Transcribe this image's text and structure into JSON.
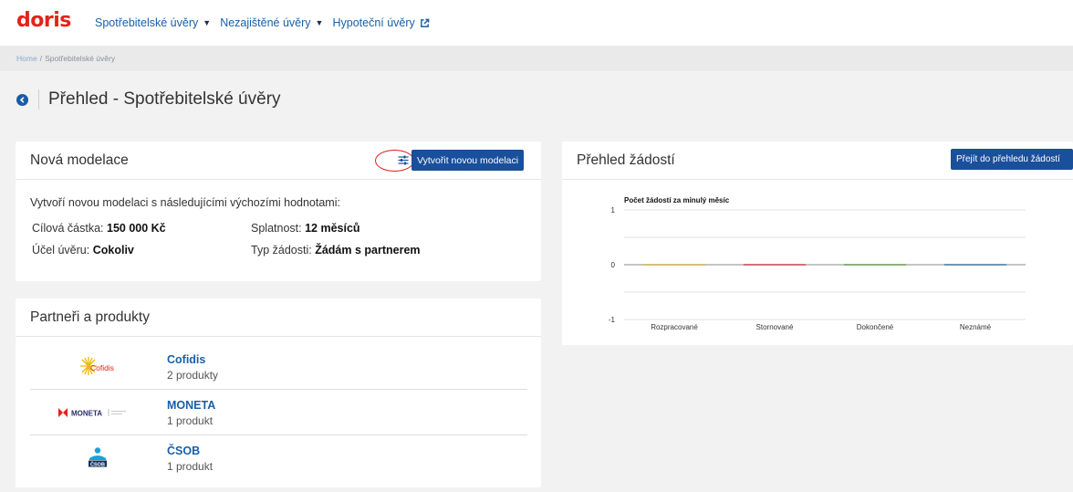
{
  "nav": {
    "logo": "doris",
    "items": [
      {
        "label": "Spotřebitelské úvěry",
        "icon": "caret-down-icon"
      },
      {
        "label": "Nezajištěné úvěry",
        "icon": "caret-down-icon"
      },
      {
        "label": "Hypoteční úvěry",
        "icon": "external-link-icon"
      }
    ]
  },
  "breadcrumb": {
    "home": "Home",
    "separator": "/",
    "current": "Spotřebitelské úvěry"
  },
  "page": {
    "title": "Přehled - Spotřebitelské úvěry",
    "back_icon": "back-arrow-icon"
  },
  "nova": {
    "title": "Nová modelace",
    "settings_icon": "sliders-icon",
    "create_button": "Vytvořit novou modelaci",
    "description": "Vytvoří novou modelaci s následujícími výchozími hodnotami:",
    "fields": {
      "amount_label": "Cílová částka:",
      "amount_value": "150 000 Kč",
      "maturity_label": "Splatnost:",
      "maturity_value": "12 měsíců",
      "purpose_label": "Účel úvěru:",
      "purpose_value": "Cokoliv",
      "type_label": "Typ žádosti:",
      "type_value": "Žádám s partnerem"
    }
  },
  "partners": {
    "title": "Partneři a produkty",
    "items": [
      {
        "name": "Cofidis",
        "count": "2 produkty",
        "logo_text": "Cofidis"
      },
      {
        "name": "MONETA",
        "count": "1 produkt",
        "logo_text": "MONETA"
      },
      {
        "name": "ČSOB",
        "count": "1 produkt",
        "logo_text": "ČSOB"
      }
    ]
  },
  "prehled": {
    "title": "Přehled žádostí",
    "button": "Přejít do přehledu žádostí"
  },
  "colors": {
    "brand_red": "#e2231a",
    "link_blue": "#1a5fa8",
    "button_blue": "#1a4f9c",
    "annotation_red": "#e11d1d"
  },
  "chart_data": {
    "type": "bar",
    "title": "Počet žádostí za minulý měsíc",
    "categories": [
      "Rozpracované",
      "Stornované",
      "Dokončené",
      "Neznámé"
    ],
    "values": [
      0,
      0,
      0,
      0
    ],
    "ylim": [
      -1,
      1
    ],
    "yticks": [
      "1",
      "0",
      "-1"
    ],
    "bar_colors": [
      "#c8b15a",
      "#c0505a",
      "#6aa05a",
      "#4a7fa0"
    ],
    "grid": true,
    "xlabel": "",
    "ylabel": ""
  }
}
